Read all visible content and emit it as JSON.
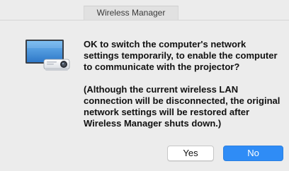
{
  "window": {
    "title": "Wireless Manager"
  },
  "icon": {
    "name": "projector-screen-icon"
  },
  "message": {
    "primary": "OK to switch the computer's network settings temporarily, to enable the computer to communicate with the projector?",
    "secondary": "(Although the current wireless LAN connection will be disconnected, the original network settings will be restored after Wireless Manager shuts down.)"
  },
  "buttons": {
    "yes_label": "Yes",
    "no_label": "No"
  },
  "colors": {
    "background": "#ececec",
    "default_button": "#2f8cf6",
    "default_button_text": "#ffffff"
  }
}
